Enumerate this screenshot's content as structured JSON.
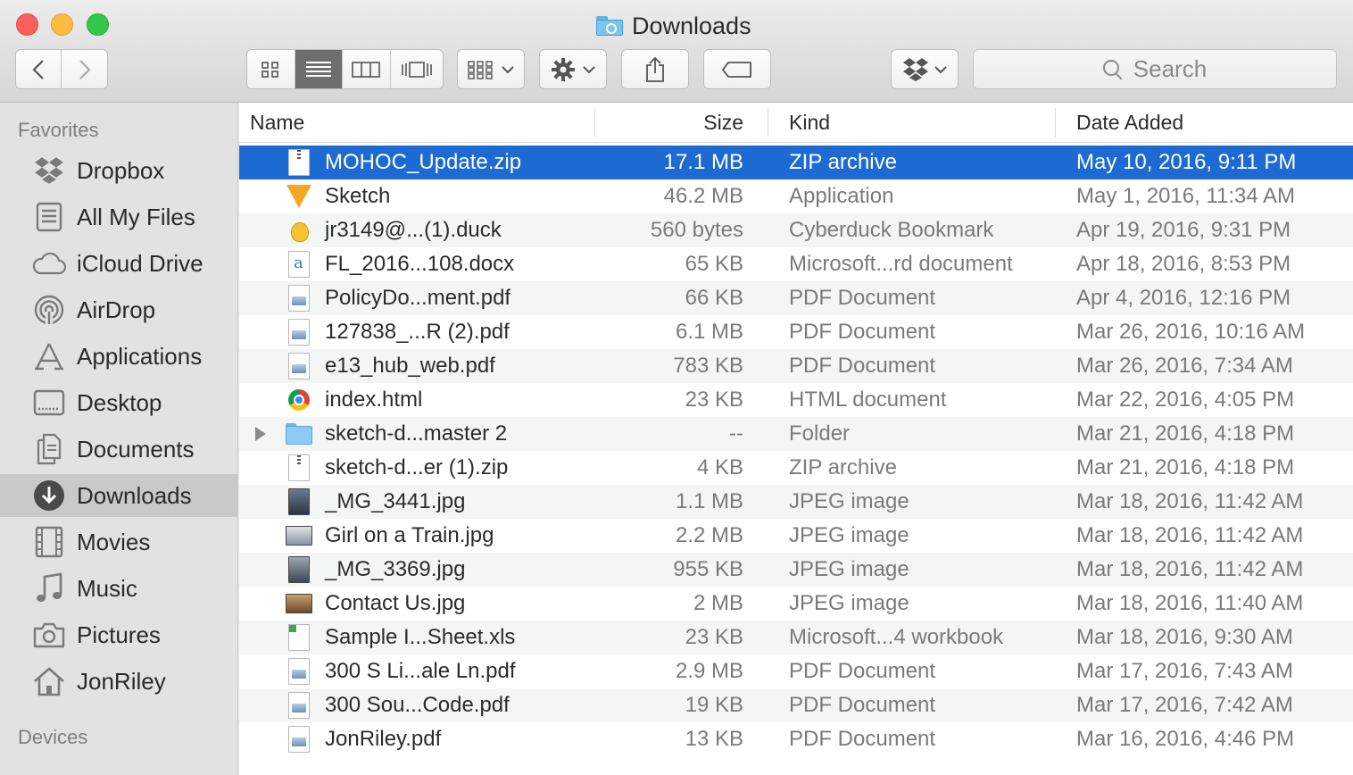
{
  "window": {
    "title": "Downloads"
  },
  "toolbar": {
    "back_icon": "chevron-left-icon",
    "forward_icon": "chevron-right-icon",
    "view_modes": [
      "icon-view",
      "list-view",
      "column-view",
      "cover-flow-view"
    ],
    "active_view": "list-view",
    "search_placeholder": "Search"
  },
  "sidebar": {
    "favorites_header": "Favorites",
    "devices_header": "Devices",
    "items": [
      {
        "label": "Dropbox",
        "icon": "dropbox-icon"
      },
      {
        "label": "All My Files",
        "icon": "all-files-icon"
      },
      {
        "label": "iCloud Drive",
        "icon": "cloud-icon"
      },
      {
        "label": "AirDrop",
        "icon": "airdrop-icon"
      },
      {
        "label": "Applications",
        "icon": "applications-icon"
      },
      {
        "label": "Desktop",
        "icon": "desktop-icon"
      },
      {
        "label": "Documents",
        "icon": "documents-icon"
      },
      {
        "label": "Downloads",
        "icon": "downloads-icon",
        "selected": true
      },
      {
        "label": "Movies",
        "icon": "film-icon"
      },
      {
        "label": "Music",
        "icon": "music-note-icon"
      },
      {
        "label": "Pictures",
        "icon": "camera-icon"
      },
      {
        "label": "JonRiley",
        "icon": "home-icon"
      }
    ]
  },
  "list": {
    "columns": {
      "name": "Name",
      "size": "Size",
      "kind": "Kind",
      "date": "Date Added"
    },
    "rows": [
      {
        "name": "MOHOC_Update.zip",
        "size": "17.1 MB",
        "kind": "ZIP archive",
        "date": "May 10, 2016, 9:11 PM",
        "icon": "zip-file-icon",
        "selected": true
      },
      {
        "name": "Sketch",
        "size": "46.2 MB",
        "kind": "Application",
        "date": "May 1, 2016, 11:34 AM",
        "icon": "sketch-app-icon"
      },
      {
        "name": "jr3149@...(1).duck",
        "size": "560 bytes",
        "kind": "Cyberduck Bookmark",
        "date": "Apr 19, 2016, 9:31 PM",
        "icon": "cyberduck-icon"
      },
      {
        "name": "FL_2016...108.docx",
        "size": "65 KB",
        "kind": "Microsoft...rd document",
        "date": "Apr 18, 2016, 8:53 PM",
        "icon": "word-doc-icon"
      },
      {
        "name": "PolicyDo...ment.pdf",
        "size": "66 KB",
        "kind": "PDF Document",
        "date": "Apr 4, 2016, 12:16 PM",
        "icon": "pdf-file-icon"
      },
      {
        "name": "127838_...R (2).pdf",
        "size": "6.1 MB",
        "kind": "PDF Document",
        "date": "Mar 26, 2016, 10:16 AM",
        "icon": "pdf-file-icon"
      },
      {
        "name": "e13_hub_web.pdf",
        "size": "783 KB",
        "kind": "PDF Document",
        "date": "Mar 26, 2016, 7:34 AM",
        "icon": "pdf-file-icon"
      },
      {
        "name": "index.html",
        "size": "23 KB",
        "kind": "HTML document",
        "date": "Mar 22, 2016, 4:05 PM",
        "icon": "chrome-html-icon"
      },
      {
        "name": "sketch-d...master 2",
        "size": "--",
        "kind": "Folder",
        "date": "Mar 21, 2016, 4:18 PM",
        "icon": "folder-icon",
        "disclosure": true
      },
      {
        "name": "sketch-d...er (1).zip",
        "size": "4 KB",
        "kind": "ZIP archive",
        "date": "Mar 21, 2016, 4:18 PM",
        "icon": "zip-file-icon"
      },
      {
        "name": "_MG_3441.jpg",
        "size": "1.1 MB",
        "kind": "JPEG image",
        "date": "Mar 18, 2016, 11:42 AM",
        "icon": "jpeg-image-icon"
      },
      {
        "name": "Girl on a Train.jpg",
        "size": "2.2 MB",
        "kind": "JPEG image",
        "date": "Mar 18, 2016, 11:42 AM",
        "icon": "jpeg-image-icon"
      },
      {
        "name": "_MG_3369.jpg",
        "size": "955 KB",
        "kind": "JPEG image",
        "date": "Mar 18, 2016, 11:42 AM",
        "icon": "jpeg-image-icon"
      },
      {
        "name": "Contact Us.jpg",
        "size": "2 MB",
        "kind": "JPEG image",
        "date": "Mar 18, 2016, 11:40 AM",
        "icon": "jpeg-image-icon"
      },
      {
        "name": "Sample I...Sheet.xls",
        "size": "23 KB",
        "kind": "Microsoft...4 workbook",
        "date": "Mar 18, 2016, 9:30 AM",
        "icon": "excel-file-icon"
      },
      {
        "name": "300 S Li...ale Ln.pdf",
        "size": "2.9 MB",
        "kind": "PDF Document",
        "date": "Mar 17, 2016, 7:43 AM",
        "icon": "pdf-file-icon"
      },
      {
        "name": "300 Sou...Code.pdf",
        "size": "19 KB",
        "kind": "PDF Document",
        "date": "Mar 17, 2016, 7:42 AM",
        "icon": "pdf-file-icon"
      },
      {
        "name": "JonRiley.pdf",
        "size": "13 KB",
        "kind": "PDF Document",
        "date": "Mar 16, 2016, 4:46 PM",
        "icon": "pdf-file-icon"
      }
    ]
  },
  "colors": {
    "selection": "#1d6ad3",
    "sidebar_bg": "#e3e2e3",
    "close": "#fc605c",
    "minimize": "#fdbc40",
    "maximize": "#34c749"
  }
}
